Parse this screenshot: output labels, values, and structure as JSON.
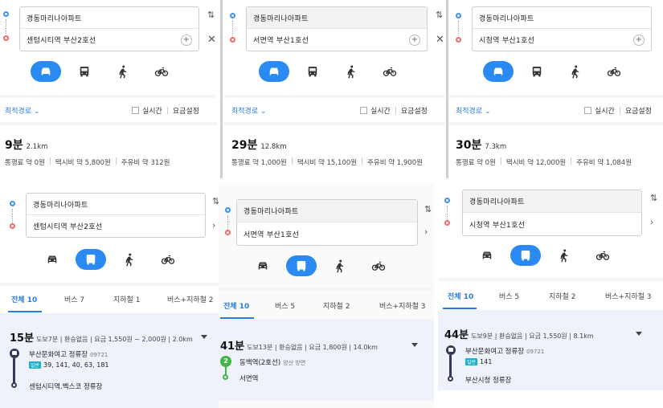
{
  "icons": {
    "car": "car-icon",
    "bus": "bus-icon",
    "walk": "walk-icon",
    "bike": "bike-icon",
    "swap": "swap-icon",
    "close": "close-icon",
    "add": "add-icon"
  },
  "colors": {
    "accent": "#2b8af2",
    "subway_line2": "#44b544",
    "bus_line": "#2f3b57"
  },
  "panels": [
    {
      "origin": "경동마리나아파트",
      "destination": "센텀시티역 부산2호선",
      "option_label": "최적경로 ⌄",
      "realtime_label": "실시간",
      "fee_settings_label": "요금설정",
      "time": "9분",
      "distance": "2.1km",
      "fees": [
        "통행료 약 0원",
        "택시비 약 5,800원",
        "주유비 약 312원"
      ]
    },
    {
      "origin": "경동마리나아파트",
      "destination": "서면역 부산1호선",
      "option_label": "최적경로 ⌄",
      "realtime_label": "실시간",
      "fee_settings_label": "요금설정",
      "time": "29분",
      "distance": "12.8km",
      "fees": [
        "통행료 약 1,000원",
        "택시비 약 15,100원",
        "주유비 약 1,900원"
      ]
    },
    {
      "origin": "경동마리나아파트",
      "destination": "시청역 부산1호선",
      "option_label": "최적경로 ⌄",
      "realtime_label": "실시간",
      "fee_settings_label": "요금설정",
      "time": "30분",
      "distance": "7.3km",
      "fees": [
        "통행료 약 0원",
        "택시비 약 12,000원",
        "주유비 약 1,084원"
      ]
    },
    {
      "origin": "경동마리나아파트",
      "destination": "센텀시티역 부산2호선",
      "tabs": [
        "전체 10",
        "버스 7",
        "지하철 1",
        "버스+지하철 2"
      ],
      "route": {
        "time": "15분",
        "meta": "도보7분 | 환승없음 | 요금 1,550원 ~ 2,000원 | 2.0km",
        "stop1": "부산문화여고 정류장",
        "stop1_code": "09721",
        "bus_type": "일반",
        "bus_numbers": "39, 141, 40, 63, 181",
        "stop2": "센텀시티역.벡스코 정류장"
      }
    },
    {
      "origin": "경동마리나아파트",
      "destination": "서면역 부산1호선",
      "tabs": [
        "전체 10",
        "버스 5",
        "지하철 2",
        "버스+지하철 3"
      ],
      "route": {
        "time": "41분",
        "meta": "도보13분 | 환승없음 | 요금 1,800원 | 14.0km",
        "line_no": "2",
        "stop1": "동백역(2호선)",
        "stop1_dir": "양산 방면",
        "stop2": "서면역"
      }
    },
    {
      "origin": "경동마리나아파트",
      "destination": "시청역 부산1호선",
      "tabs": [
        "전체 10",
        "버스 5",
        "지하철 2",
        "버스+지하철 3"
      ],
      "route": {
        "time": "44분",
        "meta": "도보9분 | 환승없음 | 요금 1,550원 | 8.1km",
        "stop1": "부산문화여고 정류장",
        "stop1_code": "09721",
        "bus_type": "일반",
        "bus_numbers": "141",
        "stop2": "부산시청 정류장"
      }
    }
  ]
}
